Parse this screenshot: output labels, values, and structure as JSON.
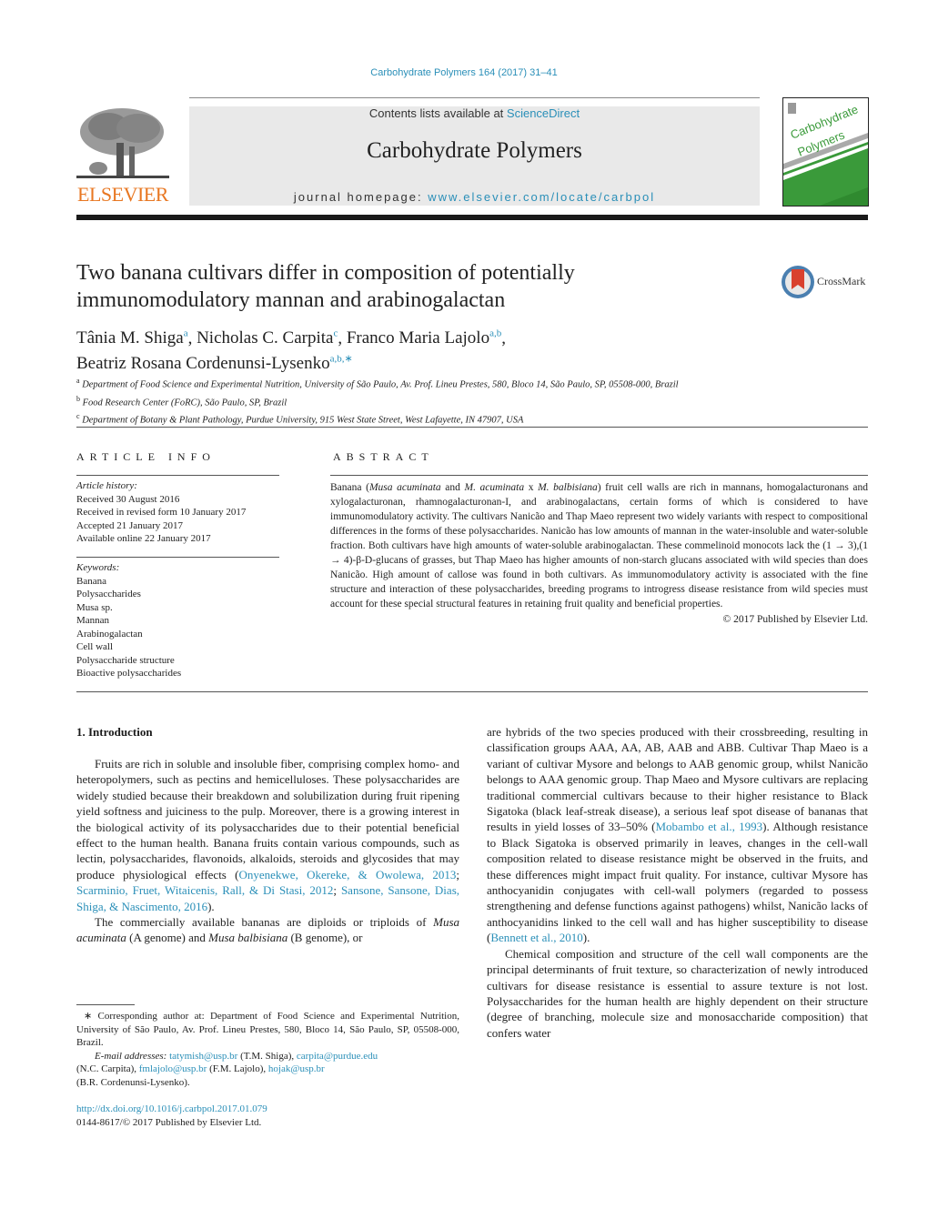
{
  "header": {
    "citation": "Carbohydrate Polymers 164 (2017) 31–41",
    "contents_prefix": "Contents lists available at ",
    "contents_link": "ScienceDirect",
    "journal_name": "Carbohydrate Polymers",
    "homepage_prefix": "journal homepage: ",
    "homepage_url": "www.elsevier.com/locate/carbpol",
    "publisher_logo": "ELSEVIER",
    "cover_title_line1": "Carbohydrate",
    "cover_title_line2": "Polymers",
    "brand_orange": "#e87722",
    "cover_green": "#3a9a3a",
    "link_color": "#2a8fb8"
  },
  "article": {
    "title": "Two banana cultivars differ in composition of potentially immunomodulatory mannan and arabinogalactan",
    "crossmark_label": "CrossMark",
    "authors": [
      {
        "name": "Tânia M. Shiga",
        "sup": "a",
        "sep": ", "
      },
      {
        "name": "Nicholas C. Carpita",
        "sup": "c",
        "sep": ", "
      },
      {
        "name": "Franco Maria Lajolo",
        "sup": "a,b",
        "sep": ","
      },
      {
        "name": "Beatriz Rosana Cordenunsi-Lysenko",
        "sup": "a,b,∗",
        "sep": ""
      }
    ],
    "affiliations": [
      {
        "key": "a",
        "text": "Department of Food Science and Experimental Nutrition, University of São Paulo, Av. Prof. Lineu Prestes, 580, Bloco 14, São Paulo, SP, 05508-000, Brazil"
      },
      {
        "key": "b",
        "text": "Food Research Center (FoRC), São Paulo, SP, Brazil"
      },
      {
        "key": "c",
        "text": "Department of Botany & Plant Pathology, Purdue University, 915 West State Street, West Lafayette, IN 47907, USA"
      }
    ]
  },
  "article_info": {
    "heading": "ARTICLE INFO",
    "history_label": "Article history:",
    "history": [
      "Received 30 August 2016",
      "Received in revised form 10 January 2017",
      "Accepted 21 January 2017",
      "Available online 22 January 2017"
    ],
    "keywords_label": "Keywords:",
    "keywords": [
      "Banana",
      "Polysaccharides",
      "Musa sp.",
      "Mannan",
      "Arabinogalactan",
      "Cell wall",
      "Polysaccharide structure",
      "Bioactive polysaccharides"
    ]
  },
  "abstract": {
    "heading": "ABSTRACT",
    "p1": "Banana (",
    "p1_i1": "Musa acuminata",
    "p1_b": " and ",
    "p1_i2": "M. acuminata",
    "p1_c": " x ",
    "p1_i3": "M. balbisiana",
    "p1_rest": ") fruit cell walls are rich in mannans, homogalacturonans and xylogalacturonan, rhamnogalacturonan-I, and arabinogalactans, certain forms of which is considered to have immunomodulatory activity. The cultivars Nanicão and Thap Maeo represent two widely variants with respect to compositional differences in the forms of these polysaccharides. Nanicão has low amounts of mannan in the water-insoluble and water-soluble fraction. Both cultivars have high amounts of water-soluble arabinogalactan. These commelinoid monocots lack the (1 → 3),(1 → 4)-β-D-glucans of grasses, but Thap Maeo has higher amounts of non-starch glucans associated with wild species than does Nanicão. High amount of callose was found in both cultivars. As immunomodulatory activity is associated with the fine structure and interaction of these polysaccharides, breeding programs to introgress disease resistance from wild species must account for these special structural features in retaining fruit quality and beneficial properties.",
    "copyright": "© 2017 Published by Elsevier Ltd."
  },
  "intro": {
    "heading": "1.  Introduction",
    "left_p1_a": "Fruits are rich in soluble and insoluble fiber, comprising complex homo- and heteropolymers, such as pectins and hemicelluloses. These polysaccharides are widely studied because their breakdown and solubilization during fruit ripening yield softness and juiciness to the pulp. Moreover, there is a growing interest in the biological activity of its polysaccharides due to their potential beneficial effect to the human health. Banana fruits contain various compounds, such as lectin, polysaccharides, flavonoids, alkaloids, steroids and glycosides that may produce physiological effects (",
    "ref1": "Onyenekwe, Okereke, & Owolewa, 2013",
    "ref2": "Scarminio, Fruet, Witaicenis, Rall, & Di Stasi, 2012",
    "ref3": "Sansone, Sansone, Dias, Shiga, & Nascimento, 2016",
    "left_p2_a": "The commercially available bananas are diploids or triploids of ",
    "left_p2_i1": "Musa acuminata",
    "left_p2_b": " (A genome) and ",
    "left_p2_i2": "Musa balbisiana",
    "left_p2_c": " (B genome), or",
    "right_p1_a": "are hybrids of the two species produced with their crossbreeding, resulting in classification groups AAA, AA, AB, AAB and ABB. Cultivar Thap Maeo is a variant of cultivar Mysore and belongs to AAB genomic group, whilst Nanicão belongs to AAA genomic group. Thap Maeo and Mysore cultivars are replacing traditional commercial cultivars because to their higher resistance to Black Sigatoka (black leaf-streak disease), a serious leaf spot disease of bananas that results in yield losses of 33–50% (",
    "ref4": "Mobambo et al., 1993",
    "right_p1_b": "). Although resistance to Black Sigatoka is observed primarily in leaves, changes in the cell-wall composition related to disease resistance might be observed in the fruits, and these differences might impact fruit quality. For instance, cultivar Mysore has anthocyanidin conjugates with cell-wall polymers (regarded to possess strengthening and defense functions against pathogens) whilst, Nanicão lacks of anthocyanidins linked to the cell wall and has higher susceptibility to disease (",
    "ref5": "Bennett et al., 2010",
    "right_p2": "Chemical composition and structure of the cell wall components are the principal determinants of fruit texture, so characterization of newly introduced cultivars for disease resistance is essential to assure texture is not lost. Polysaccharides for the human health are highly dependent on their structure (degree of branching, molecule size and monosaccharide composition) that confers water"
  },
  "footnote": {
    "corresponding": "∗  Corresponding author at: Department of Food Science and Experimental Nutrition, University of São Paulo, Av. Prof. Lineu Prestes, 580, Bloco 14, São Paulo, SP, 05508-000, Brazil.",
    "email_label": "E-mail addresses:",
    "emails": [
      {
        "addr": "tatymish@usp.br",
        "who": "(T.M. Shiga)"
      },
      {
        "addr": "carpita@purdue.edu",
        "who": "(N.C. Carpita)"
      },
      {
        "addr": "fmlajolo@usp.br",
        "who": "(F.M. Lajolo)"
      },
      {
        "addr": "hojak@usp.br",
        "who": "(B.R. Cordenunsi-Lysenko)."
      }
    ],
    "doi": "http://dx.doi.org/10.1016/j.carbpol.2017.01.079",
    "issn": "0144-8617/© 2017 Published by Elsevier Ltd."
  }
}
